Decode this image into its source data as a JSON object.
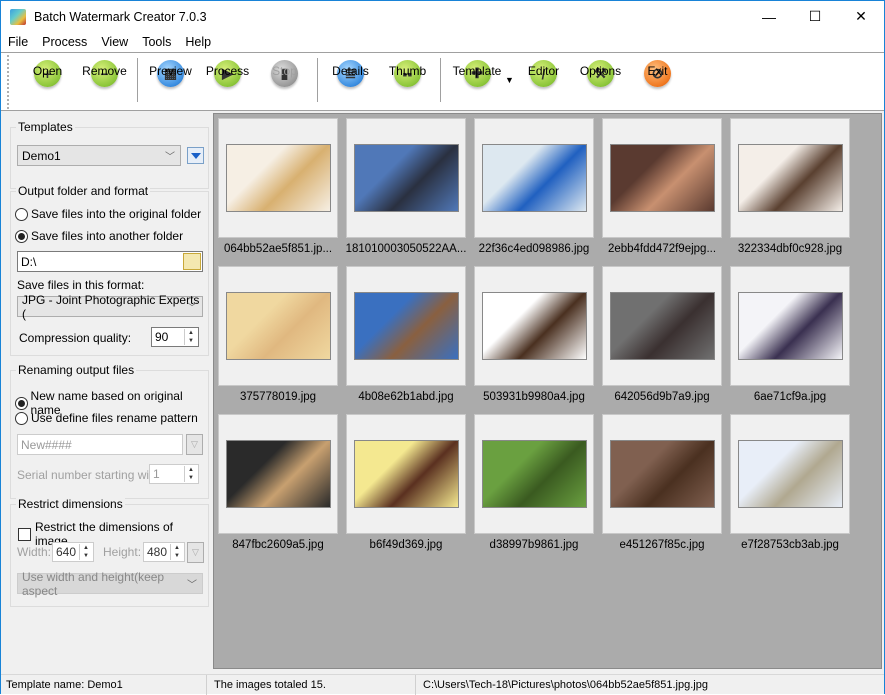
{
  "window": {
    "title": "Batch Watermark Creator 7.0.3",
    "controls": {
      "minimize": "—",
      "maximize": "☐",
      "close": "✕"
    }
  },
  "menu": [
    "File",
    "Process",
    "View",
    "Tools",
    "Help"
  ],
  "toolbar": {
    "open": "Open",
    "remove": "Remove",
    "preview": "Preview",
    "process": "Process",
    "stop": "Stop",
    "details": "Details",
    "thumb": "Thumb",
    "template": "Template",
    "editor": "Editor",
    "options": "Options",
    "exit": "Exit"
  },
  "left": {
    "templates": {
      "title": "Templates",
      "selected": "Demo1"
    },
    "output": {
      "title": "Output folder and format",
      "radio_original": "Save files into the original folder",
      "radio_another": "Save files into another folder",
      "selected": "another",
      "folder": "D:\\",
      "format_label": "Save files in this format:",
      "format": "JPG - Joint Photographic Experts (",
      "quality_label": "Compression quality:",
      "quality": "90"
    },
    "renaming": {
      "title": "Renaming output files",
      "radio_original": "New name based on original name",
      "radio_pattern": "Use define files rename pattern",
      "selected": "original",
      "pattern": "New####",
      "serial_label": "Serial number starting with",
      "serial": "1"
    },
    "dimensions": {
      "title": "Restrict dimensions",
      "checkbox": "Restrict the dimensions of image",
      "checked": false,
      "width_label": "Width:",
      "width": "640",
      "height_label": "Height:",
      "height": "480",
      "mode": "Use width and height(keep aspect"
    }
  },
  "gallery": {
    "images": [
      {
        "name": "064bb52ae5f851.jp...",
        "colors": [
          "#f6efe4",
          "#d8b070"
        ]
      },
      {
        "name": "181010003050522AA...",
        "colors": [
          "#5078b8",
          "#2a3040"
        ]
      },
      {
        "name": "22f36c4ed098986.jpg",
        "colors": [
          "#dde8f0",
          "#2060c0"
        ]
      },
      {
        "name": "2ebb4fdd472f9ejpg...",
        "colors": [
          "#5a3a30",
          "#c89070"
        ]
      },
      {
        "name": "322334dbf0c928.jpg",
        "colors": [
          "#f4eee8",
          "#5a4030"
        ]
      },
      {
        "name": "375778019.jpg",
        "colors": [
          "#f0d8a0",
          "#e0b880"
        ]
      },
      {
        "name": "4b08e62b1abd.jpg",
        "colors": [
          "#3a70c0",
          "#8a6040"
        ]
      },
      {
        "name": "503931b9980a4.jpg",
        "colors": [
          "#ffffff",
          "#4a3020"
        ]
      },
      {
        "name": "642056d9b7a9.jpg",
        "colors": [
          "#707070",
          "#3a3030"
        ]
      },
      {
        "name": "6ae71cf9a.jpg",
        "colors": [
          "#f4f4f8",
          "#3a3050"
        ]
      },
      {
        "name": "847fbc2609a5.jpg",
        "colors": [
          "#2a2a2a",
          "#c8a070"
        ]
      },
      {
        "name": "b6f49d369.jpg",
        "colors": [
          "#f4e890",
          "#5a3020"
        ]
      },
      {
        "name": "d38997b9861.jpg",
        "colors": [
          "#6aa040",
          "#3a5a20"
        ]
      },
      {
        "name": "e451267f85c.jpg",
        "colors": [
          "#806050",
          "#4a3020"
        ]
      },
      {
        "name": "e7f28753cb3ab.jpg",
        "colors": [
          "#e8eef8",
          "#b0a890"
        ]
      }
    ]
  },
  "status": {
    "template": "Template name: Demo1",
    "total": "The images totaled 15.",
    "path": "C:\\Users\\Tech-18\\Pictures\\photos\\064bb52ae5f851.jpg.jpg"
  }
}
